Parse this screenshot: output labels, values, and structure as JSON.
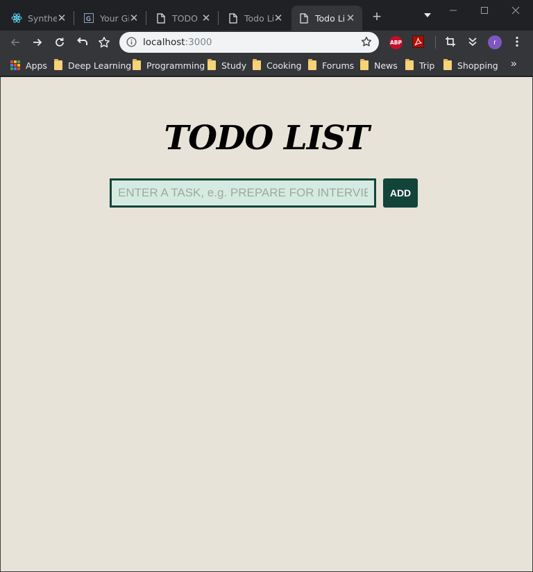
{
  "browser": {
    "tabs": [
      {
        "title": "Synthet",
        "icon": "react-icon",
        "active": false
      },
      {
        "title": "Your Gi",
        "icon": "site-logo-icon",
        "active": false
      },
      {
        "title": "TODO L",
        "icon": "document-icon",
        "active": false
      },
      {
        "title": "Todo Li",
        "icon": "document-icon",
        "active": false
      },
      {
        "title": "Todo Li",
        "icon": "document-icon",
        "active": true
      }
    ],
    "address": {
      "host": "localhost",
      "port": ":3000"
    },
    "extensions": {
      "abp_label": "ABP",
      "avatar_initial": "r"
    },
    "bookmarks": [
      {
        "label": "Apps",
        "icon": "apps-grid-icon"
      },
      {
        "label": "Deep Learning",
        "icon": "folder-icon"
      },
      {
        "label": "Programming",
        "icon": "folder-icon"
      },
      {
        "label": "Study",
        "icon": "folder-icon"
      },
      {
        "label": "Cooking",
        "icon": "folder-icon"
      },
      {
        "label": "Forums",
        "icon": "folder-icon"
      },
      {
        "label": "News",
        "icon": "folder-icon"
      },
      {
        "label": "Trip",
        "icon": "folder-icon"
      },
      {
        "label": "Shopping",
        "icon": "folder-icon"
      }
    ],
    "bookmarks_overflow": "»"
  },
  "app": {
    "title": "TODO LIST",
    "input": {
      "value": "",
      "placeholder": "ENTER A TASK, e.g. PREPARE FOR INTERVIEW"
    },
    "add_button": "ADD"
  },
  "colors": {
    "page_background": "#e8e3d8",
    "accent": "#13443a",
    "input_background": "#d5ebe1"
  }
}
